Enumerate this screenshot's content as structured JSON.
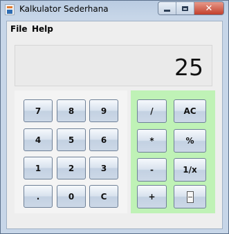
{
  "window": {
    "title": "Kalkulator Sederhana",
    "controls": [
      "minimize",
      "maximize",
      "close"
    ],
    "close_symbol": "✕"
  },
  "menu": {
    "items": [
      "File",
      "Help"
    ]
  },
  "display": {
    "value": "25"
  },
  "numpad": {
    "rows": [
      [
        "7",
        "8",
        "9"
      ],
      [
        "4",
        "5",
        "6"
      ],
      [
        "1",
        "2",
        "3"
      ],
      [
        ".",
        "0",
        "C"
      ]
    ]
  },
  "ops": {
    "rows": [
      [
        "/",
        "AC"
      ],
      [
        "*",
        "%"
      ],
      [
        "-",
        "1/x"
      ],
      [
        "+",
        ""
      ]
    ],
    "last_icon": "equals-box-icon"
  },
  "colors": {
    "ops_panel_bg": "#bff2b6",
    "numpad_bg": "#f4f4f4",
    "display_bg": "#eaeaea"
  }
}
